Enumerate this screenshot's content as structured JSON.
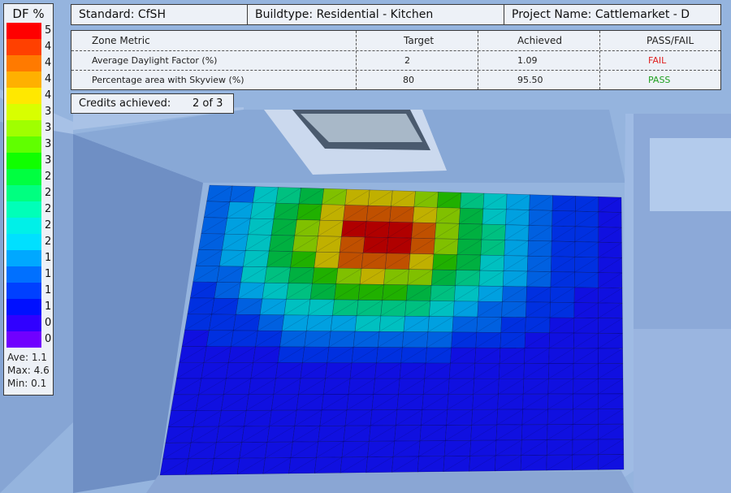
{
  "header": {
    "standard": "Standard: CfSH",
    "buildtype": "Buildtype: Residential - Kitchen",
    "project": "Project Name: Cattlemarket - D"
  },
  "table": {
    "columns": [
      "Zone Metric",
      "Target",
      "Achieved",
      "PASS/FAIL"
    ],
    "rows": [
      {
        "metric": "Average Daylight Factor (%)",
        "target": "2",
        "achieved": "1.09",
        "result": "FAIL",
        "result_color": "#e02020"
      },
      {
        "metric": "Percentage area with Skyview (%)",
        "target": "80",
        "achieved": "95.50",
        "result": "PASS",
        "result_color": "#20a020"
      }
    ]
  },
  "credits": {
    "label": "Credits achieved:",
    "value": "2 of 3"
  },
  "legend": {
    "title": "DF %",
    "scale": [
      {
        "label": "5",
        "color": "#ff0000"
      },
      {
        "label": "4",
        "color": "#ff4000"
      },
      {
        "label": "4",
        "color": "#ff7a00"
      },
      {
        "label": "4",
        "color": "#ffb000"
      },
      {
        "label": "4",
        "color": "#ffe800"
      },
      {
        "label": "3",
        "color": "#d8ff00"
      },
      {
        "label": "3",
        "color": "#a0ff00"
      },
      {
        "label": "3",
        "color": "#60ff00"
      },
      {
        "label": "3",
        "color": "#10ff00"
      },
      {
        "label": "2",
        "color": "#00ff40"
      },
      {
        "label": "2",
        "color": "#00ff80"
      },
      {
        "label": "2",
        "color": "#00ffb8"
      },
      {
        "label": "2",
        "color": "#00f0e8"
      },
      {
        "label": "2",
        "color": "#00e0ff"
      },
      {
        "label": "1",
        "color": "#00a8ff"
      },
      {
        "label": "1",
        "color": "#0070ff"
      },
      {
        "label": "1",
        "color": "#0040ff"
      },
      {
        "label": "1",
        "color": "#0010ff"
      },
      {
        "label": "0",
        "color": "#3000ff"
      },
      {
        "label": "0",
        "color": "#7000ff"
      }
    ],
    "ave": "Ave: 1.1",
    "max": "Max: 4.6",
    "min": "Min: 0.1"
  }
}
